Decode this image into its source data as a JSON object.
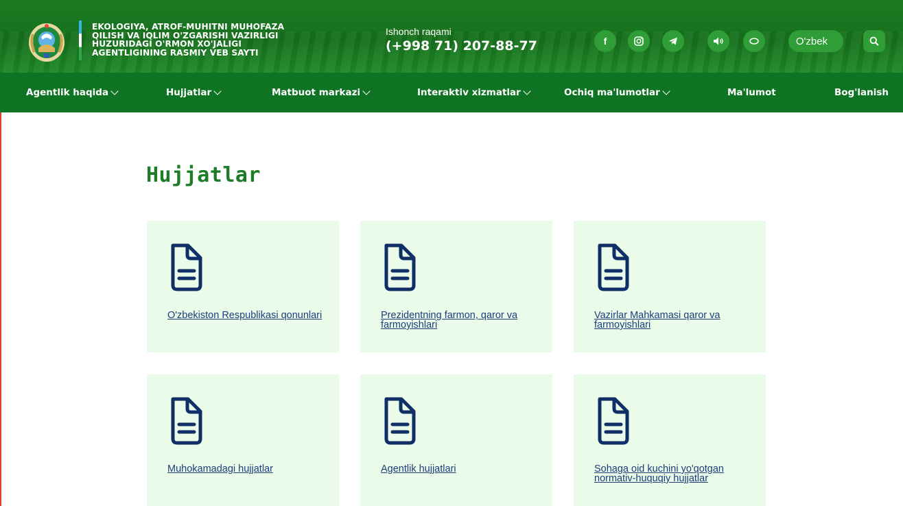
{
  "header": {
    "agency_name": "EKOLOGIYA, ATROF-MUHITNI MUHOFAZA QILISH VA IQLIM O'ZGARISHI VAZIRLIGI HUZURIDAGI O'RMON XO'JALIGI AGENTLIGINING RASMIY VEB SAYTI",
    "phone_label": "Ishonch raqami",
    "phone_number": "(+998 71) 207-88-77",
    "social": {
      "facebook": "f",
      "instagram_icon": "instagram-icon",
      "telegram_icon": "telegram-icon",
      "sound_icon": "speaker-icon",
      "eye_icon": "eye-icon"
    },
    "language": "O'zbek",
    "search_icon": "search-icon"
  },
  "nav": {
    "items": [
      {
        "label": "Agentlik haqida",
        "dropdown": true
      },
      {
        "label": "Hujjatlar",
        "dropdown": true
      },
      {
        "label": "Matbuot markazi",
        "dropdown": true
      },
      {
        "label": "Interaktiv xizmatlar",
        "dropdown": true
      },
      {
        "label": "Ochiq ma'lumotlar",
        "dropdown": true
      },
      {
        "label": "Ma'lumot",
        "dropdown": false
      },
      {
        "label": "Bog'lanish",
        "dropdown": false
      }
    ]
  },
  "main": {
    "title": "Hujjatlar",
    "cards": [
      {
        "label": "O'zbekiston Respublikasi qonunlari"
      },
      {
        "label": "Prezidentning farmon, qaror va farmoyishlari"
      },
      {
        "label": "Vazirlar Mahkamasi qaror va farmoyishlari"
      },
      {
        "label": "Muhokamadagi hujjatlar"
      },
      {
        "label": "Agentlik hujjatlari"
      },
      {
        "label": "Sohaga oid kuchini yo'qotgan normativ-huquqiy hujjatlar"
      }
    ]
  },
  "colors": {
    "header_green": "#17711d",
    "nav_green": "#0e7322",
    "title_green": "#1e7b28",
    "card_bg": "#ebfbea",
    "icon_navy": "#0f2f66",
    "link_navy": "#1d3d7a"
  }
}
